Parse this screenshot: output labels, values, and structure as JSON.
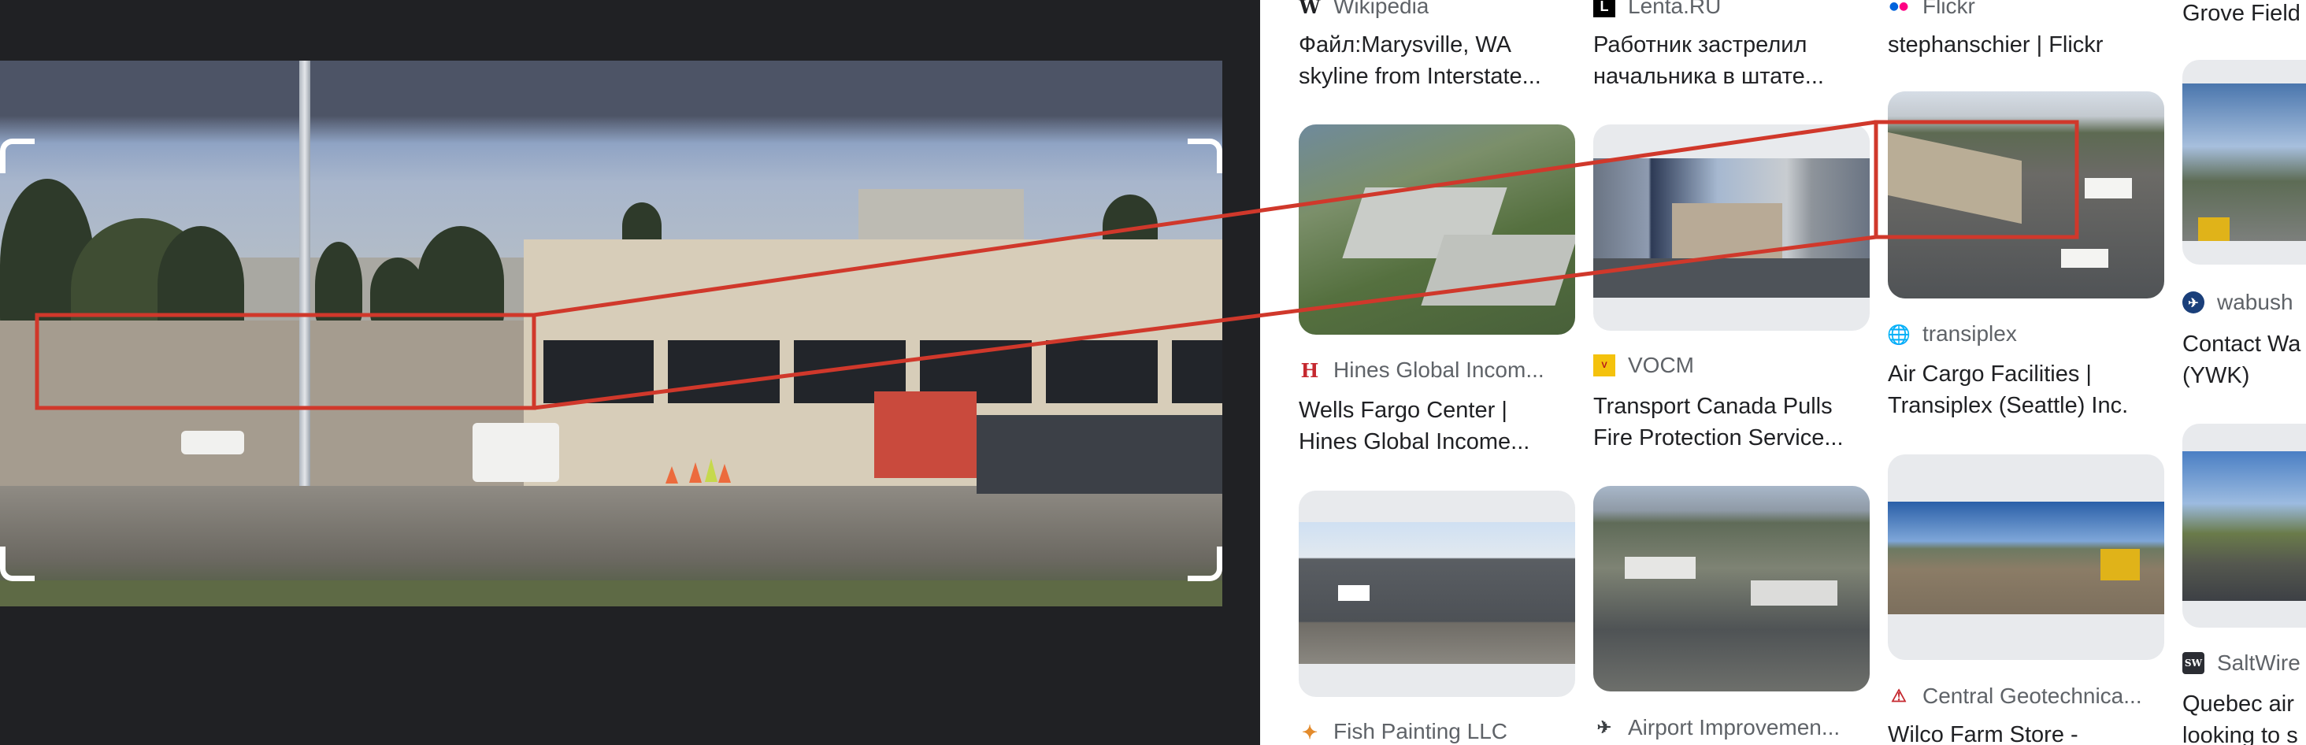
{
  "colors": {
    "highlight": "#d0382b",
    "panel_bg": "#202124",
    "results_bg": "#ffffff",
    "source_text": "#5f6368",
    "title_text": "#202124"
  },
  "results": {
    "col1": {
      "top": {
        "source_icon": "wikipedia-icon",
        "source": "Wikipedia",
        "title_line1": "Файл:Marysville, WA",
        "title_line2": "skyline from Interstate..."
      },
      "card2": {
        "source_icon": "hines-icon",
        "source": "Hines Global Incom...",
        "title_line1": "Wells Fargo Center |",
        "title_line2": "Hines Global Income..."
      },
      "card3": {
        "source_icon": "fish-painting-icon",
        "source": "Fish Painting LLC"
      }
    },
    "col2": {
      "top": {
        "source_icon": "lenta-icon",
        "source": "Lenta.RU",
        "title_line1": "Работник застрелил",
        "title_line2": "начальника в штате..."
      },
      "card2": {
        "source_icon": "vocm-icon",
        "source": "VOCM",
        "title_line1": "Transport Canada Pulls",
        "title_line2": "Fire Protection Service..."
      },
      "card3": {
        "source_icon": "airport-icon",
        "source": "Airport Improvemen..."
      }
    },
    "col3": {
      "top": {
        "source_icon": "flickr-icon",
        "source": "Flickr",
        "title_line1": "stephanschier | Flickr"
      },
      "card2": {
        "source_icon": "globe-icon",
        "source": "transiplex",
        "title_line1": "Air Cargo Facilities |",
        "title_line2": "Transiplex (Seattle) Inc."
      },
      "card3": {
        "source_icon": "central-geotech-icon",
        "source": "Central Geotechnica...",
        "title_line1": "Wilco Farm Store -"
      }
    },
    "col4": {
      "top": {
        "title_line1": "Grove Field"
      },
      "card2": {
        "source_icon": "wabush-icon",
        "source": "wabush",
        "title_line1": "Contact Wa",
        "title_line2": "(YWK)"
      },
      "card3": {
        "source_icon": "saltwire-icon",
        "source": "SaltWire",
        "title_line1": "Quebec air",
        "title_line2": "looking to s"
      }
    }
  }
}
